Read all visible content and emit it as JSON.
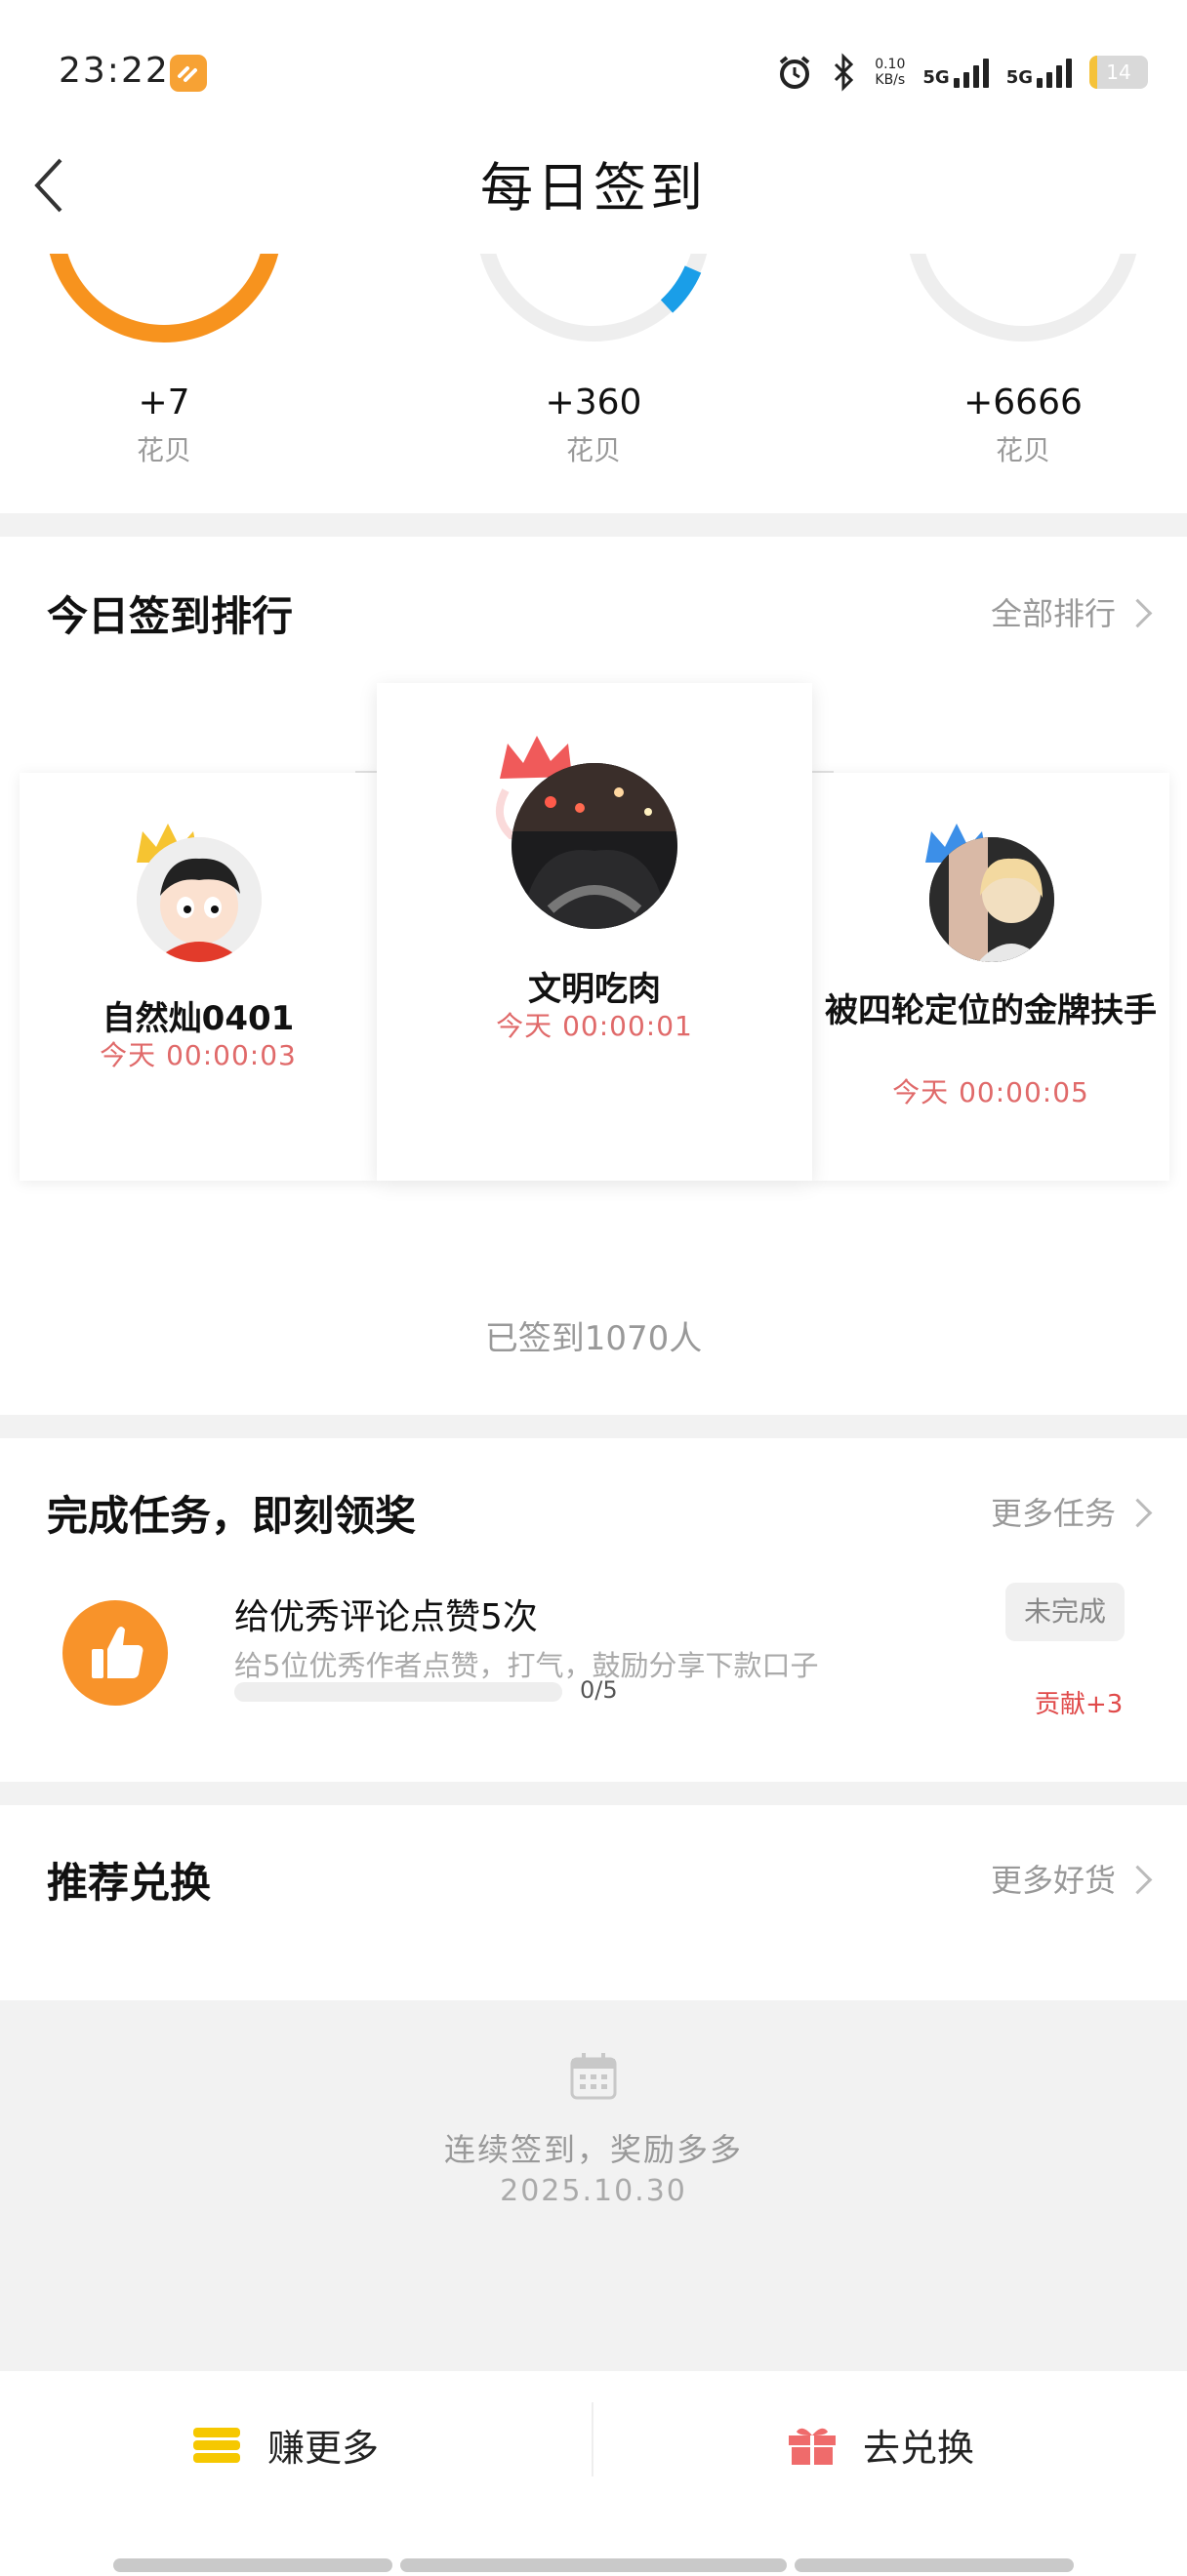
{
  "status_bar": {
    "time": "23:22",
    "app_badge_icon": "app-badge-icon",
    "net_speed_value": "0.10",
    "net_speed_unit": "KB/s",
    "signal1_label": "5G",
    "signal2_label": "5G",
    "battery": "14",
    "battery_level": 0.14,
    "battery_color": "#f5c23a"
  },
  "header": {
    "title": "每日签到",
    "back_icon": "chevron-left-icon"
  },
  "rewards": [
    {
      "value": "+7",
      "unit": "花贝",
      "ring_color": "#f7931e"
    },
    {
      "value": "+360",
      "unit": "花贝",
      "ring_color": "#1a9ee8"
    },
    {
      "value": "+6666",
      "unit": "花贝",
      "ring_color": "#eeeeee"
    }
  ],
  "ranking": {
    "title": "今日签到排行",
    "more": "全部排行",
    "first": {
      "name": "文明吃肉",
      "time": "今天 00:00:01",
      "crown_color": "#f05a5a"
    },
    "second": {
      "name": "自然灿0401",
      "time": "今天 00:00:03",
      "crown_color": "#f6c431"
    },
    "third": {
      "name": "被四轮定位的金牌扶手",
      "time": "今天 00:00:05",
      "crown_color": "#3c8fe8"
    },
    "count": "已签到1070人"
  },
  "tasks": {
    "title": "完成任务，即刻领奖",
    "more": "更多任务",
    "items": [
      {
        "title": "给优秀评论点赞5次",
        "desc": "给5位优秀作者点赞，打气，鼓励分享下款口子",
        "progress": "0/5",
        "progress_fraction": 0,
        "status": "未完成",
        "reward": "贡献+3",
        "icon": "thumbs-up-icon"
      }
    ]
  },
  "recommend": {
    "title": "推荐兑换",
    "more": "更多好货",
    "empty_icon": "calendar-icon",
    "empty_text": "连续签到，奖励多多",
    "empty_date": "2025.10.30"
  },
  "bottom_bar": {
    "earn_label": "赚更多",
    "earn_icon": "coins-icon",
    "redeem_label": "去兑换",
    "redeem_icon": "gift-icon"
  }
}
